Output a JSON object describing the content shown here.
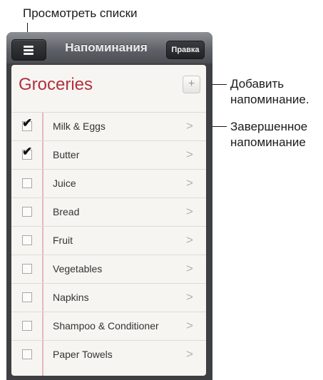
{
  "callouts": {
    "view_lists": "Просмотреть списки",
    "add_reminder_line1": "Добавить",
    "add_reminder_line2": "напоминание.",
    "completed_line1": "Завершенное",
    "completed_line2": "напоминание"
  },
  "navbar": {
    "menu_icon": "list-menu-icon",
    "title": "Напоминания",
    "edit_label": "Правка"
  },
  "list": {
    "title": "Groceries",
    "add_symbol": "+",
    "chevron": ">",
    "tick": "✔",
    "items": [
      {
        "label": "Milk & Eggs",
        "completed": true
      },
      {
        "label": "Butter",
        "completed": true
      },
      {
        "label": "Juice",
        "completed": false
      },
      {
        "label": "Bread",
        "completed": false
      },
      {
        "label": "Fruit",
        "completed": false
      },
      {
        "label": "Vegetables",
        "completed": false
      },
      {
        "label": "Napkins",
        "completed": false
      },
      {
        "label": "Shampoo & Conditioner",
        "completed": false
      },
      {
        "label": "Paper Towels",
        "completed": false
      }
    ]
  },
  "colors": {
    "title_red": "#b2303f",
    "margin_line": "#e9b6be",
    "paper": "#f6f5f1",
    "navbar": "#5f6268"
  }
}
